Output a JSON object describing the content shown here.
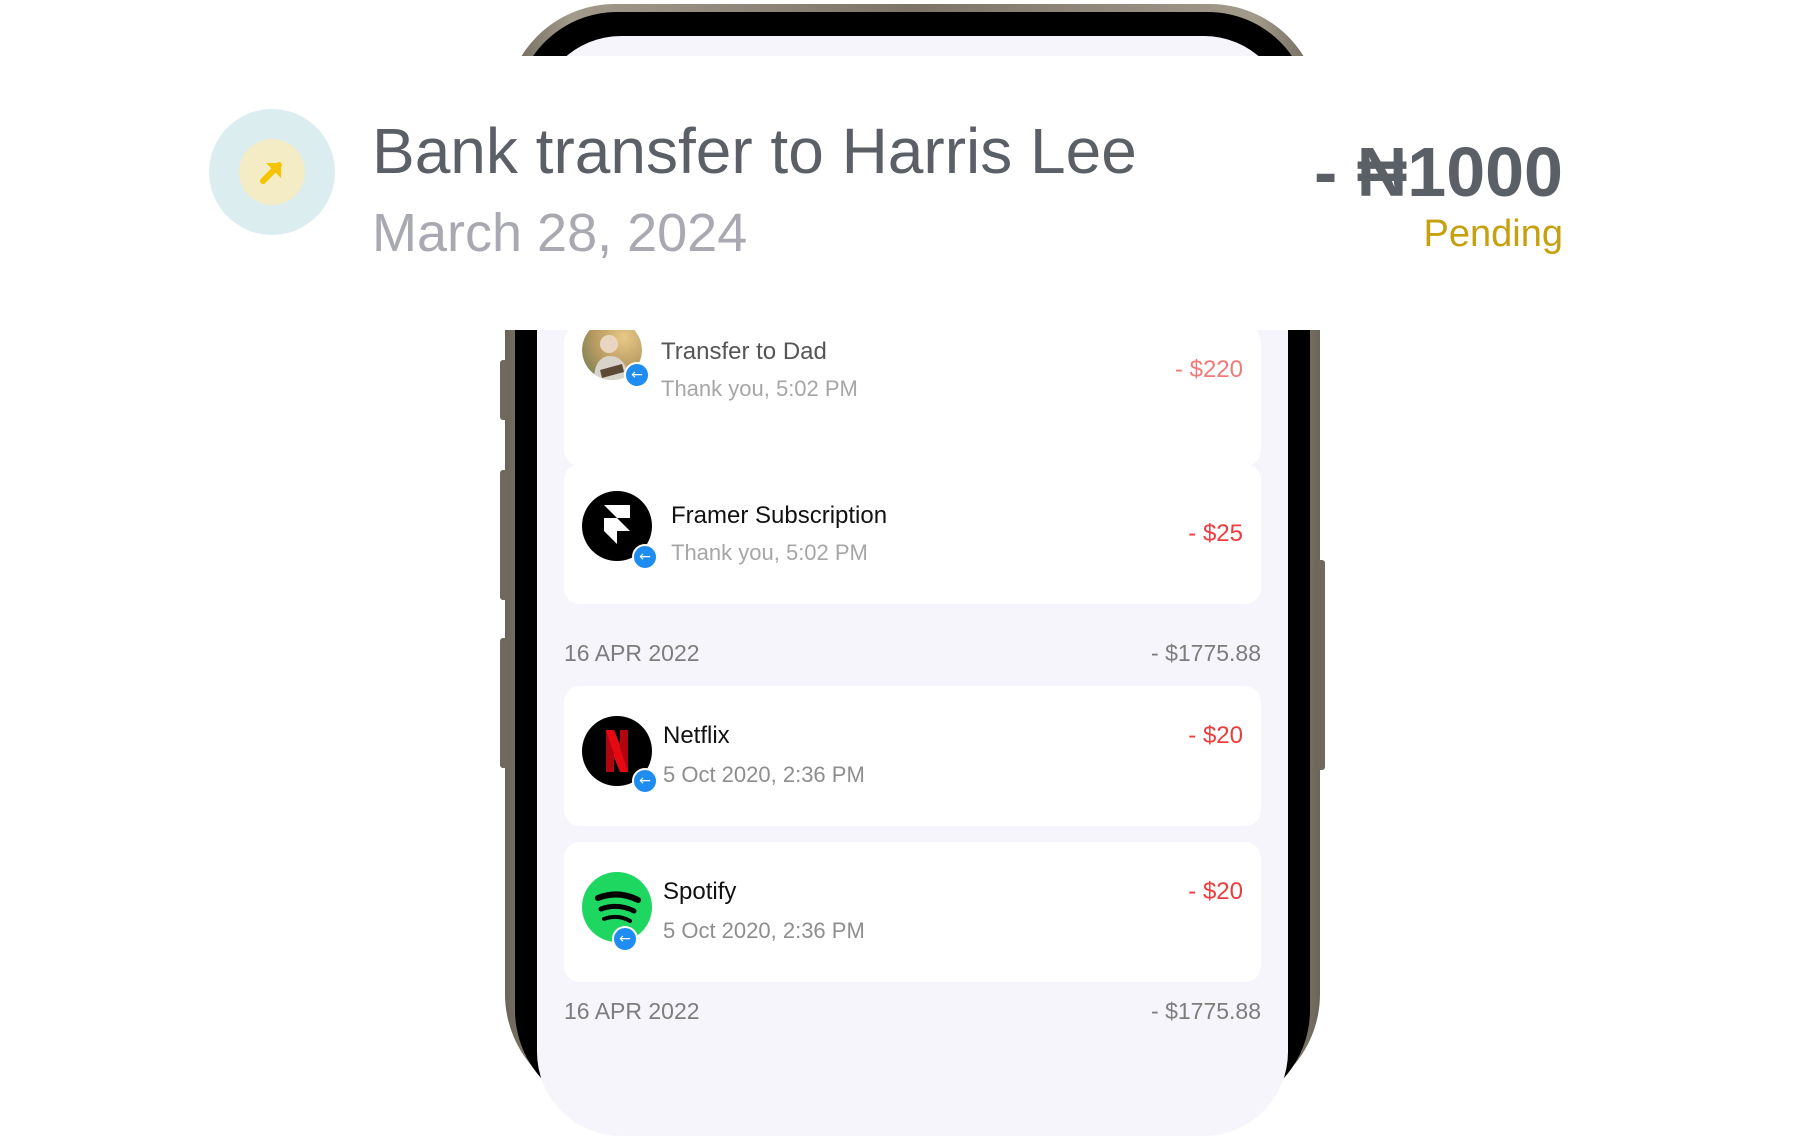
{
  "header": {
    "title": "Bank transfer to Harris Lee",
    "date": "March 28, 2024",
    "amount": "- ₦1000",
    "status": "Pending",
    "status_color": "#c7a00e",
    "icon": "arrow-up-right-icon"
  },
  "transactions": {
    "group1": [
      {
        "name": "Transfer to Dad",
        "subtitle": "Thank you, 5:02 PM",
        "amount": "- $220",
        "icon": "avatar-dad"
      },
      {
        "name": "Framer Subscription",
        "subtitle": "Thank you, 5:02 PM",
        "amount": "- $25",
        "icon": "framer-logo-icon"
      }
    ],
    "group2_header": {
      "date": "16 APR 2022",
      "total": "- $1775.88"
    },
    "group2": [
      {
        "name": "Netflix",
        "subtitle": "5 Oct 2020, 2:36 PM",
        "amount": "- $20",
        "icon": "netflix-logo-icon"
      },
      {
        "name": "Spotify",
        "subtitle": "5 Oct 2020, 2:36 PM",
        "amount": "- $20",
        "icon": "spotify-logo-icon"
      }
    ],
    "group3_header": {
      "date": "16 APR 2022",
      "total": "- $1775.88"
    }
  },
  "badge_icon": "arrow-left-icon",
  "colors": {
    "debit": "#ee3b3b",
    "badge": "#1e8cf0",
    "screen_bg": "#f5f5fb"
  }
}
